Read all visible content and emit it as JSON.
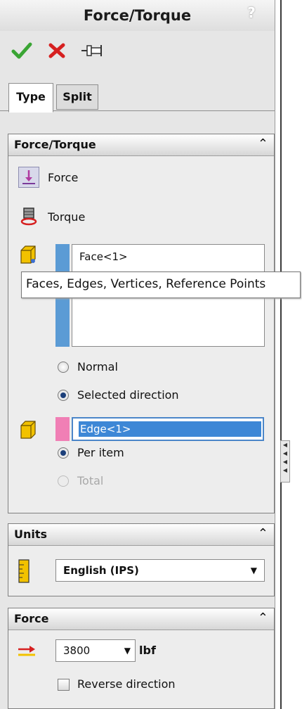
{
  "panel": {
    "title": "Force/Torque",
    "help_glyph": "?",
    "actions": [
      {
        "name": "ok",
        "icon": "green-checkmark-icon"
      },
      {
        "name": "cancel",
        "icon": "red-x-icon"
      },
      {
        "name": "pin",
        "icon": "pushpin-icon"
      }
    ]
  },
  "tabs": [
    {
      "label": "Type",
      "active": true
    },
    {
      "label": "Split",
      "active": false
    }
  ],
  "force_torque_group": {
    "title": "Force/Torque",
    "options": [
      {
        "label": "Force",
        "selected": true
      },
      {
        "label": "Torque",
        "selected": false
      }
    ],
    "faces_list": {
      "items": [
        "Face<1>"
      ],
      "strip_color": "#5b9bd5"
    },
    "tooltip": "Faces, Edges, Vertices, Reference Points",
    "direction_options": [
      {
        "label": "Normal",
        "selected": false
      },
      {
        "label": "Selected direction",
        "selected": true
      }
    ],
    "direction_field": {
      "value": "Edge<1>",
      "strip_color": "#f07fb5"
    },
    "distribution_options": [
      {
        "label": "Per item",
        "selected": true,
        "enabled": true
      },
      {
        "label": "Total",
        "selected": false,
        "enabled": false
      }
    ]
  },
  "units_group": {
    "title": "Units",
    "selected": "English (IPS)"
  },
  "force_group": {
    "title": "Force",
    "value": "3800",
    "unit": "lbf",
    "reverse_direction_label": "Reverse direction",
    "reverse_direction_checked": false
  },
  "colors": {
    "accent_blue": "#3d87d6",
    "selection_blue_strip": "#5b9bd5",
    "selection_pink_strip": "#f07fb5"
  }
}
